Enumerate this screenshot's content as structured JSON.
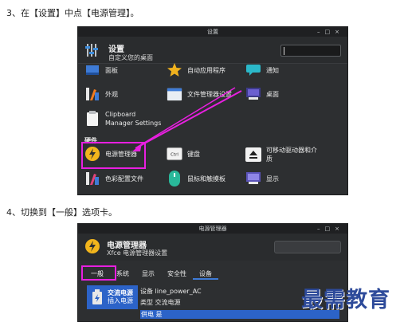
{
  "step3": "3、在【设置】中点【电源管理】。",
  "step4": "4、切换到【一般】选项卡。",
  "settings_window": {
    "title": "设置",
    "header_title": "设置",
    "header_subtitle": "自定义您的桌面",
    "items": {
      "panel": "面板",
      "autostart": "自动应用程序",
      "notify": "通知",
      "appearance": "外观",
      "file_manager": "文件管理器设置",
      "desktop": "桌面",
      "clipboard_line1": "Clipboard",
      "clipboard_line2": "Manager Settings",
      "power": "电源管理器",
      "keyboard": "键盘",
      "removable_line1": "可移动驱动器和介",
      "removable_line2": "质",
      "color": "色彩配置文件",
      "mouse": "鼠标和触摸板",
      "display": "显示"
    },
    "section_hardware": "硬件",
    "keyboard_icon_text": "Ctrl"
  },
  "power_window": {
    "title": "电源管理器",
    "header_title": "电源管理器",
    "header_subtitle": "Xfce 电源管理器设置",
    "tabs": [
      "一般",
      "系统",
      "显示",
      "安全性",
      "设备"
    ],
    "device": {
      "name": "交流电源",
      "status": "插入电源"
    },
    "properties": [
      {
        "key": "设备",
        "value": "line_power_AC"
      },
      {
        "key": "类型",
        "value": "交流电源"
      },
      {
        "key": "供电",
        "value": "是"
      }
    ]
  },
  "watermark": "最需教育",
  "colors": {
    "highlight": "#e81fe0",
    "accent_blue": "#2c63c8",
    "window_bg": "#2d2f31"
  }
}
